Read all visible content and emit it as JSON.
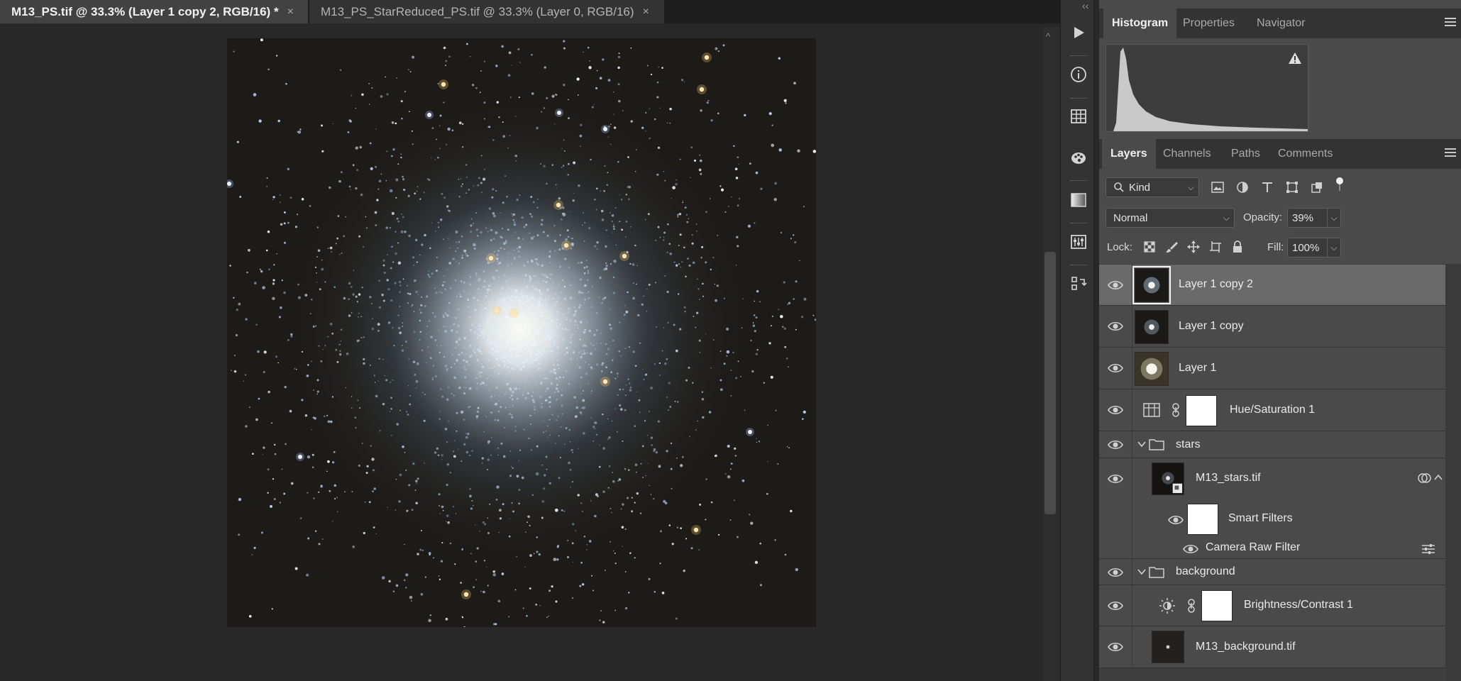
{
  "document_tabs": [
    {
      "label": "M13_PS.tif @ 33.3% (Layer 1 copy 2, RGB/16) *",
      "active": true
    },
    {
      "label": "M13_PS_StarReduced_PS.tif @ 33.3% (Layer 0, RGB/16)",
      "active": false
    }
  ],
  "tab_close_glyph": "×",
  "collapse_glyph": "‹‹",
  "scroll_up_glyph": "^",
  "tool_strip_icons": [
    "play-icon",
    "info-icon",
    "table-icon",
    "palette-icon",
    "gradient-icon",
    "adjustments-icon",
    "history-icon"
  ],
  "top_panel": {
    "tabs": [
      "Histogram",
      "Properties",
      "Navigator"
    ],
    "active_tab": "Histogram",
    "warning_icon": "warning-icon"
  },
  "layers_panel": {
    "tabs": [
      "Layers",
      "Channels",
      "Paths",
      "Comments"
    ],
    "active_tab": "Layers",
    "filter_kind": "Kind",
    "blend_mode": "Normal",
    "opacity_label": "Opacity:",
    "opacity": "39%",
    "lock_label": "Lock:",
    "fill_label": "Fill:",
    "fill": "100%",
    "layers": [
      {
        "name": "Layer 1 copy 2",
        "selected": true
      },
      {
        "name": "Layer 1 copy"
      },
      {
        "name": "Layer 1"
      },
      {
        "name": "Hue/Saturation 1"
      },
      {
        "name": "stars"
      },
      {
        "name": "M13_stars.tif"
      },
      {
        "name": "Smart Filters"
      },
      {
        "name": "Camera Raw Filter"
      },
      {
        "name": "background"
      },
      {
        "name": "Brightness/Contrast 1"
      },
      {
        "name": "M13_background.tif"
      }
    ]
  },
  "colors": {
    "app_bg": "#282828",
    "panel_bg": "#4a4a4a",
    "selected_row": "#6a6a6a",
    "star_warm": "#ffcf6e",
    "star_cool": "#a9c8ff"
  }
}
